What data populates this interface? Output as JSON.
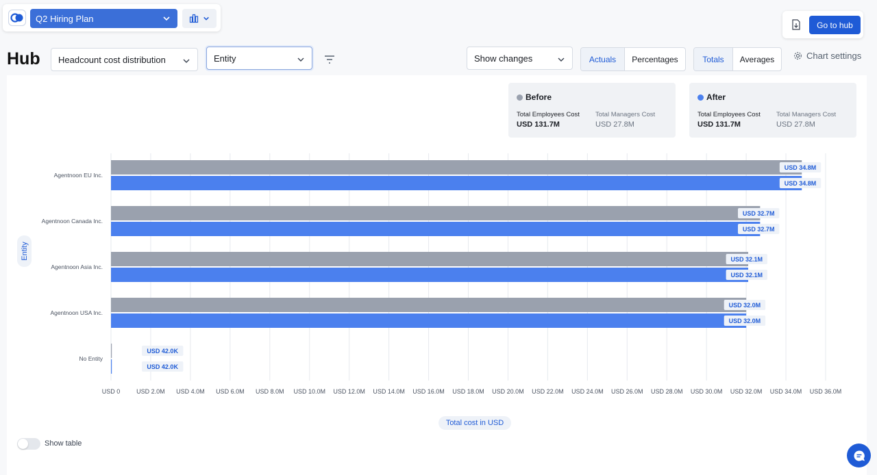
{
  "plan": {
    "name": "Q2 Hiring Plan"
  },
  "header": {
    "go_to_hub": "Go to hub"
  },
  "toolbar": {
    "title": "Hub",
    "metric": "Headcount cost distribution",
    "group_by": "Entity",
    "changes": "Show changes",
    "mode_actuals": "Actuals",
    "mode_percentages": "Percentages",
    "agg_totals": "Totals",
    "agg_averages": "Averages",
    "chart_settings": "Chart settings"
  },
  "legend": {
    "before": {
      "name": "Before",
      "color": "#9aa1ae",
      "employees_label": "Total Employees Cost",
      "employees_value": "USD 131.7M",
      "managers_label": "Total Managers Cost",
      "managers_value": "USD 27.8M"
    },
    "after": {
      "name": "After",
      "color": "#4b80ee",
      "employees_label": "Total Employees Cost",
      "employees_value": "USD 131.7M",
      "managers_label": "Total Managers Cost",
      "managers_value": "USD 27.8M"
    }
  },
  "chart_data": {
    "type": "bar",
    "orientation": "horizontal",
    "categories": [
      "Agentnoon EU Inc.",
      "Agentnoon Canada Inc.",
      "Agentnoon Asia Inc.",
      "Agentnoon USA Inc.",
      "No Entity"
    ],
    "series": [
      {
        "name": "Before",
        "color": "#9aa1ae",
        "values": [
          34.8,
          32.7,
          32.1,
          32.0,
          0.042
        ],
        "labels": [
          "USD 34.8M",
          "USD 32.7M",
          "USD 32.1M",
          "USD 32.0M",
          "USD 42.0K"
        ]
      },
      {
        "name": "After",
        "color": "#4b80ee",
        "values": [
          34.8,
          32.7,
          32.1,
          32.0,
          0.042
        ],
        "labels": [
          "USD 34.8M",
          "USD 32.7M",
          "USD 32.1M",
          "USD 32.0M",
          "USD 42.0K"
        ]
      }
    ],
    "xlim": [
      0,
      36
    ],
    "x_ticks": [
      0,
      2,
      4,
      6,
      8,
      10,
      12,
      14,
      16,
      18,
      20,
      22,
      24,
      26,
      28,
      30,
      32,
      34,
      36
    ],
    "x_tick_labels": [
      "USD 0",
      "USD 2.0M",
      "USD 4.0M",
      "USD 6.0M",
      "USD 8.0M",
      "USD 10.0M",
      "USD 12.0M",
      "USD 14.0M",
      "USD 16.0M",
      "USD 18.0M",
      "USD 20.0M",
      "USD 22.0M",
      "USD 24.0M",
      "USD 26.0M",
      "USD 28.0M",
      "USD 30.0M",
      "USD 32.0M",
      "USD 34.0M",
      "USD 36.0M"
    ],
    "xlabel": "Total cost in USD",
    "ylabel": "Entity",
    "grid": true
  },
  "footer": {
    "show_table": "Show table"
  }
}
